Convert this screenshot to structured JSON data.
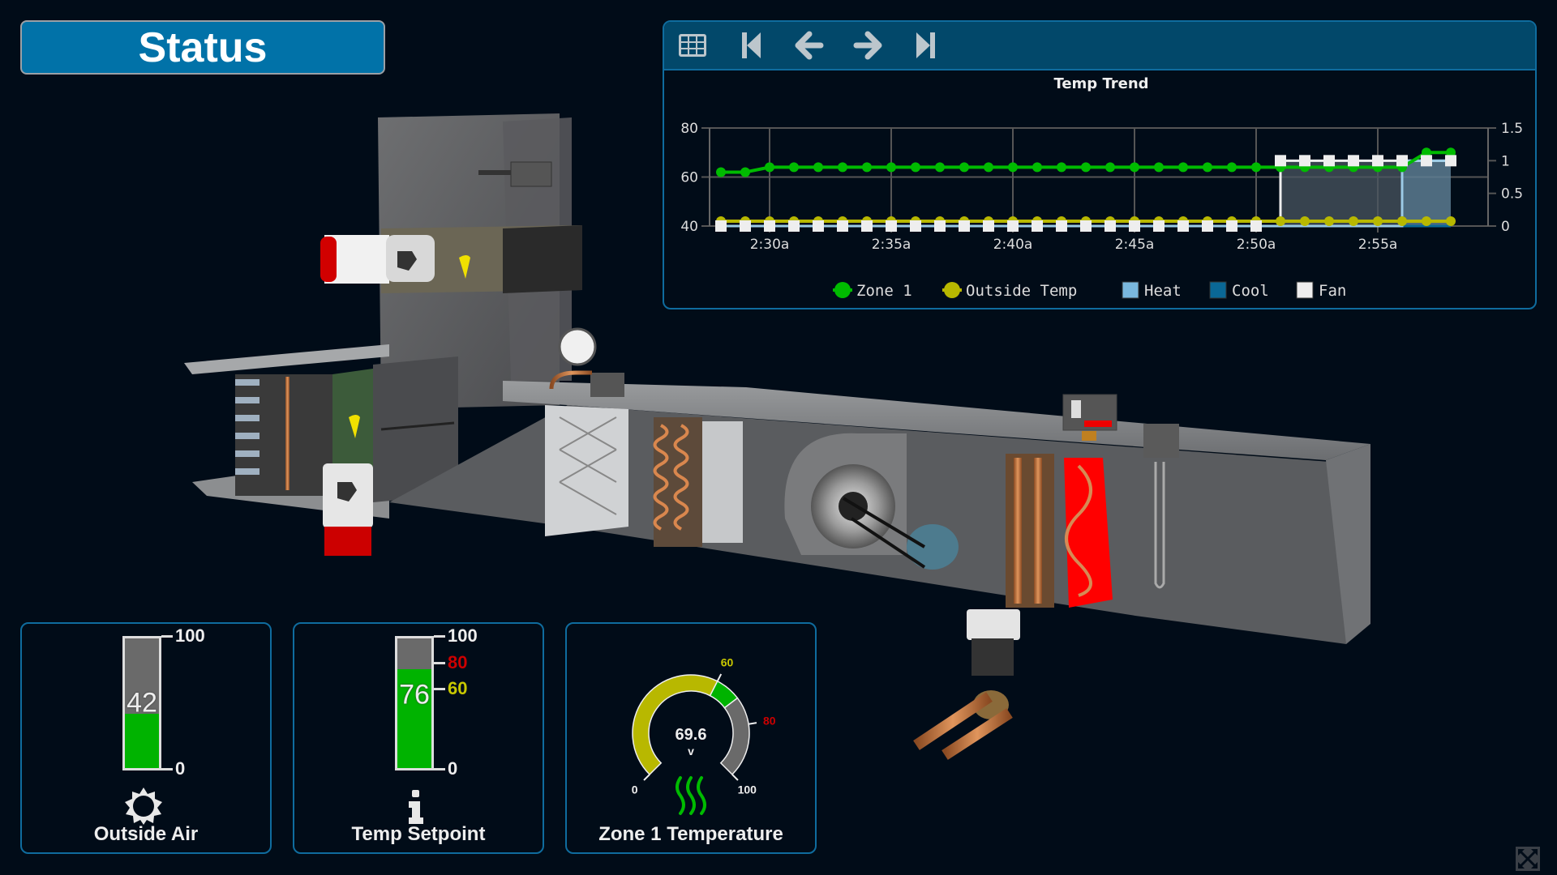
{
  "header": {
    "status_label": "Status"
  },
  "trend": {
    "toolbar": {
      "table_icon": "table-grid-icon",
      "first_icon": "skip-to-start-icon",
      "prev_icon": "arrow-left-icon",
      "next_icon": "arrow-right-icon",
      "last_icon": "skip-to-end-icon"
    }
  },
  "chart_data": {
    "type": "line",
    "title": "Temp Trend",
    "xlabel": "",
    "ylabel": "",
    "x": [
      "2:28a",
      "2:29a",
      "2:30a",
      "2:31a",
      "2:32a",
      "2:33a",
      "2:34a",
      "2:35a",
      "2:36a",
      "2:37a",
      "2:38a",
      "2:39a",
      "2:40a",
      "2:41a",
      "2:42a",
      "2:43a",
      "2:44a",
      "2:45a",
      "2:46a",
      "2:47a",
      "2:48a",
      "2:49a",
      "2:50a",
      "2:51a",
      "2:52a",
      "2:53a",
      "2:54a",
      "2:55a",
      "2:56a",
      "2:57a",
      "2:58a"
    ],
    "x_ticks": [
      "2:30a",
      "2:35a",
      "2:40a",
      "2:45a",
      "2:50a",
      "2:55a"
    ],
    "x_tick_index": [
      2,
      7,
      12,
      17,
      22,
      27
    ],
    "ylim_left": [
      40,
      80
    ],
    "yticks_left": [
      "40",
      "60",
      "80"
    ],
    "ylim_right": [
      0,
      1.5
    ],
    "yticks_right": [
      "0",
      "0.5",
      "1",
      "1.5"
    ],
    "grid": true,
    "legend_position": "bottom",
    "series": [
      {
        "name": "Zone 1",
        "axis": "left",
        "style": "line-dot",
        "color": "#00bb00",
        "values": [
          62,
          62,
          64,
          64,
          64,
          64,
          64,
          64,
          64,
          64,
          64,
          64,
          64,
          64,
          64,
          64,
          64,
          64,
          64,
          64,
          64,
          64,
          64,
          64,
          64,
          64,
          64,
          64,
          64,
          70,
          70
        ]
      },
      {
        "name": "Outside Temp",
        "axis": "left",
        "style": "line-dot",
        "color": "#b8b800",
        "values": [
          42,
          42,
          42,
          42,
          42,
          42,
          42,
          42,
          42,
          42,
          42,
          42,
          42,
          42,
          42,
          42,
          42,
          42,
          42,
          42,
          42,
          42,
          42,
          42,
          42,
          42,
          42,
          42,
          42,
          42,
          42
        ]
      },
      {
        "name": "Heat",
        "axis": "right",
        "style": "step-area",
        "color": "#7ab8dd",
        "values": [
          0,
          0,
          0,
          0,
          0,
          0,
          0,
          0,
          0,
          0,
          0,
          0,
          0,
          0,
          0,
          0,
          0,
          0,
          0,
          0,
          0,
          0,
          0,
          0,
          0,
          0,
          0,
          0,
          1,
          1,
          1
        ]
      },
      {
        "name": "Cool",
        "axis": "right",
        "style": "step-area",
        "color": "#0a6896",
        "values": [
          0,
          0,
          0,
          0,
          0,
          0,
          0,
          0,
          0,
          0,
          0,
          0,
          0,
          0,
          0,
          0,
          0,
          0,
          0,
          0,
          0,
          0,
          0,
          0,
          0,
          0,
          0,
          0,
          0,
          0,
          0
        ]
      },
      {
        "name": "Fan",
        "axis": "right",
        "style": "step-area-square",
        "color": "#eeeeee",
        "values": [
          0,
          0,
          0,
          0,
          0,
          0,
          0,
          0,
          0,
          0,
          0,
          0,
          0,
          0,
          0,
          0,
          0,
          0,
          0,
          0,
          0,
          0,
          0,
          1,
          1,
          1,
          1,
          1,
          1,
          1,
          1
        ]
      }
    ]
  },
  "widgets": {
    "outside_air": {
      "label": "Outside Air",
      "value": 42,
      "value_text": "42",
      "min": 0,
      "max": 100,
      "min_label": "0",
      "max_label": "100",
      "icon": "sun-icon",
      "fill_color": "#00b300"
    },
    "temp_setpoint": {
      "label": "Temp Setpoint",
      "value": 76,
      "value_text": "76",
      "min": 0,
      "max": 100,
      "min_label": "0",
      "max_label": "100",
      "low_limit": 60,
      "low_limit_label": "60",
      "low_limit_color": "#c8c800",
      "high_limit": 80,
      "high_limit_label": "80",
      "high_limit_color": "#cc0000",
      "icon": "info-icon",
      "fill_color": "#00b300"
    },
    "zone1_temp": {
      "label": "Zone 1 Temperature",
      "value": 69.6,
      "value_text": "69.6",
      "unit": "v",
      "min": 0,
      "max": 100,
      "min_label": "0",
      "max_label": "100",
      "low_limit": 60,
      "low_limit_label": "60",
      "low_limit_color": "#c8c800",
      "high_limit": 80,
      "high_limit_label": "80",
      "high_limit_color": "#cc0000",
      "ranges": [
        {
          "from": 0,
          "to": 60,
          "color": "#b8b800"
        },
        {
          "from": 60,
          "to": 69.6,
          "color": "#00b300"
        },
        {
          "from": 69.6,
          "to": 100,
          "color": "#6a6a6a"
        }
      ],
      "icon": "heat-waves-icon"
    }
  },
  "footer": {
    "expand_icon": "fullscreen-expand-icon"
  }
}
